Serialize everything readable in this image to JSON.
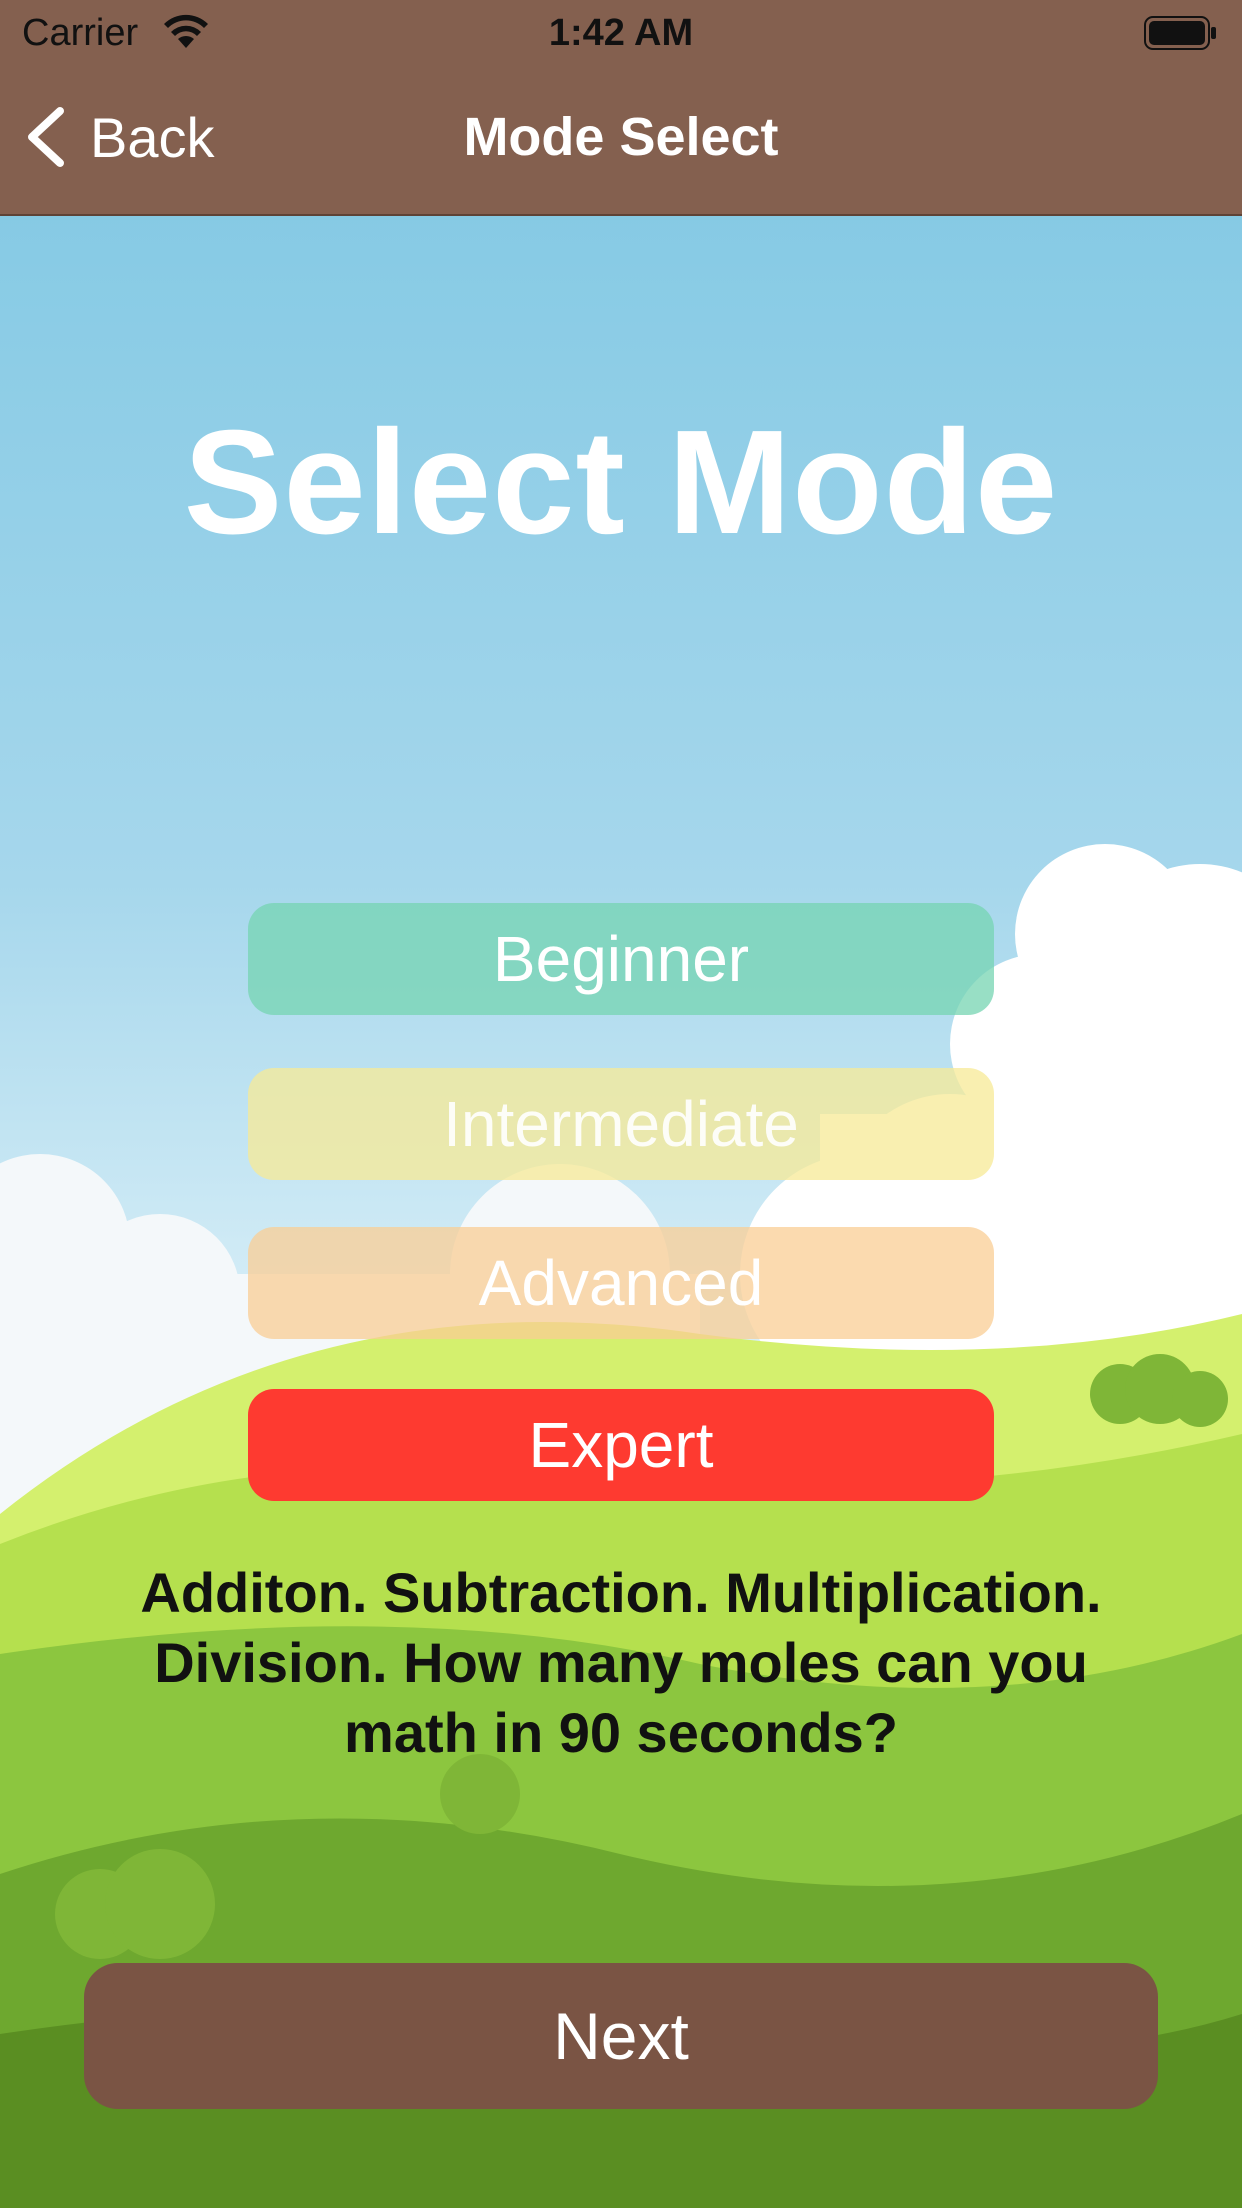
{
  "status_bar": {
    "carrier": "Carrier",
    "time": "1:42 AM",
    "icons": [
      "wifi-icon",
      "battery-icon"
    ]
  },
  "nav_bar": {
    "back_label": "Back",
    "title": "Mode Select"
  },
  "main": {
    "heading": "Select Mode",
    "modes": [
      {
        "label": "Beginner",
        "color": "#75d4b2"
      },
      {
        "label": "Intermediate",
        "color": "#f7ea96"
      },
      {
        "label": "Advanced",
        "color": "#face94"
      },
      {
        "label": "Expert",
        "color": "#fe3a30",
        "selected": true
      }
    ],
    "description": "Additon. Subtraction. Multiplication. Division. How many moles can you math in 90 seconds?"
  },
  "footer": {
    "next_label": "Next"
  },
  "colors": {
    "bar": "#84604f",
    "next_button": "#7a5444",
    "sky_top": "#7cc6e2",
    "grass": "#8cc63f"
  }
}
